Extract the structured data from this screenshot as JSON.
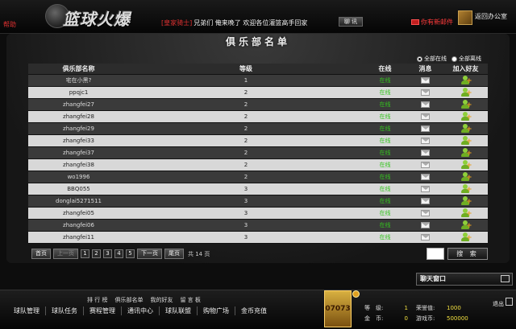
{
  "header": {
    "help": "帮助",
    "logo": "篮球火爆",
    "ticker_name": "[皇家骑士]",
    "ticker_text": "兄弟们 俺来晚了 欢迎各位灌篮高手回家",
    "ticker_button": "聊 讯",
    "mail": "你有新邮件",
    "office": "返回办公室"
  },
  "panel": {
    "title": "俱乐部名单",
    "filter_all_online": "全部在线",
    "filter_all_offline": "全部离线",
    "columns": [
      "俱乐部名称",
      "等级",
      "在线",
      "消息",
      "加入好友"
    ]
  },
  "rows": [
    {
      "name": "宅在小黑?",
      "level": "1",
      "status": "在线"
    },
    {
      "name": "ppqjc1",
      "level": "2",
      "status": "在线"
    },
    {
      "name": "zhangfei27",
      "level": "2",
      "status": "在线"
    },
    {
      "name": "zhangfei28",
      "level": "2",
      "status": "在线"
    },
    {
      "name": "zhangfei29",
      "level": "2",
      "status": "在线"
    },
    {
      "name": "zhangfei33",
      "level": "2",
      "status": "在线"
    },
    {
      "name": "zhangfei37",
      "level": "2",
      "status": "在线"
    },
    {
      "name": "zhangfei38",
      "level": "2",
      "status": "在线"
    },
    {
      "name": "wo1996",
      "level": "2",
      "status": "在线"
    },
    {
      "name": "BBQ055",
      "level": "3",
      "status": "在线"
    },
    {
      "name": "donglai5271511",
      "level": "3",
      "status": "在线"
    },
    {
      "name": "zhangfei05",
      "level": "3",
      "status": "在线"
    },
    {
      "name": "zhangfei06",
      "level": "3",
      "status": "在线"
    },
    {
      "name": "zhangfei11",
      "level": "3",
      "status": "在线"
    }
  ],
  "pager": {
    "first": "首页",
    "prev": "上一页",
    "pages": [
      "1",
      "2",
      "3",
      "4",
      "5"
    ],
    "next": "下一页",
    "last": "尾页",
    "total": "共 14 页",
    "search": "搜 索"
  },
  "chat": {
    "title": "聊天窗口"
  },
  "footer": {
    "subnav": [
      "排 行 榜",
      "俱乐部名单",
      "我的好友",
      "留 言 板"
    ],
    "mainnav": [
      "球队管理",
      "球队任务",
      "赛程管理",
      "通讯中心",
      "球队联盟",
      "购物广场",
      "金币充值"
    ],
    "avatar_text": "07073",
    "stats": [
      {
        "label1": "等　级:",
        "value1": "1",
        "label2": "荣誉值:",
        "value2": "1000"
      },
      {
        "label1": "金　币:",
        "value1": "0",
        "label2": "游戏币:",
        "value2": "500000"
      }
    ],
    "exit": "退出"
  },
  "colors": {
    "online": "#35c41f",
    "alert": "#e03030",
    "value": "#f2e040"
  }
}
